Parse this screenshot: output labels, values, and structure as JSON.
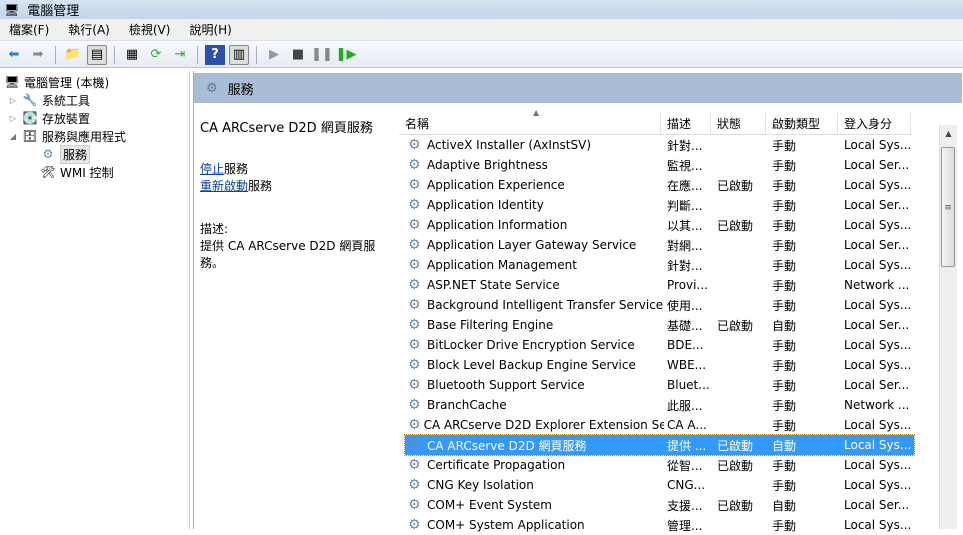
{
  "window": {
    "title": "電腦管理"
  },
  "menu": [
    "檔案(F)",
    "執行(A)",
    "檢視(V)",
    "說明(H)"
  ],
  "tree": {
    "root": "電腦管理 (本機)",
    "items": [
      {
        "label": "系統工具"
      },
      {
        "label": "存放裝置"
      },
      {
        "label": "服務與應用程式"
      },
      {
        "label": "服務"
      },
      {
        "label": "WMI 控制"
      }
    ]
  },
  "panel": {
    "header": "服務",
    "selected_title": "CA ARCserve D2D 網頁服務",
    "stop_link": "停止",
    "stop_suffix": "服務",
    "restart_link": "重新啟動",
    "restart_suffix": "服務",
    "desc_label": "描述:",
    "desc_text": "提供 CA ARCserve D2D 網頁服務。"
  },
  "columns": [
    "名稱",
    "描述",
    "狀態",
    "啟動類型",
    "登入身分"
  ],
  "services": [
    [
      "ActiveX Installer (AxInstSV)",
      "針對...",
      "",
      "手動",
      "Local Sys..."
    ],
    [
      "Adaptive Brightness",
      "監視...",
      "",
      "手動",
      "Local Ser..."
    ],
    [
      "Application Experience",
      "在應...",
      "已啟動",
      "手動",
      "Local Sys..."
    ],
    [
      "Application Identity",
      "判斷...",
      "",
      "手動",
      "Local Ser..."
    ],
    [
      "Application Information",
      "以其...",
      "已啟動",
      "手動",
      "Local Sys..."
    ],
    [
      "Application Layer Gateway Service",
      "對網...",
      "",
      "手動",
      "Local Ser..."
    ],
    [
      "Application Management",
      "針對...",
      "",
      "手動",
      "Local Sys..."
    ],
    [
      "ASP.NET State Service",
      "Provi...",
      "",
      "手動",
      "Network ..."
    ],
    [
      "Background Intelligent Transfer Service",
      "使用...",
      "",
      "手動",
      "Local Sys..."
    ],
    [
      "Base Filtering Engine",
      "基礎...",
      "已啟動",
      "自動",
      "Local Ser..."
    ],
    [
      "BitLocker Drive Encryption Service",
      "BDE...",
      "",
      "手動",
      "Local Sys..."
    ],
    [
      "Block Level Backup Engine Service",
      "WBE...",
      "",
      "手動",
      "Local Sys..."
    ],
    [
      "Bluetooth Support Service",
      "Bluet...",
      "",
      "手動",
      "Local Ser..."
    ],
    [
      "BranchCache",
      "此服...",
      "",
      "手動",
      "Network ..."
    ],
    [
      "CA ARCserve D2D Explorer Extension Se...",
      "CA A...",
      "",
      "手動",
      "Local Sys..."
    ],
    [
      "CA ARCserve D2D 網頁服務",
      "提供 ...",
      "已啟動",
      "自動",
      "Local Sys..."
    ],
    [
      "Certificate Propagation",
      "從智...",
      "已啟動",
      "手動",
      "Local Sys..."
    ],
    [
      "CNG Key Isolation",
      "CNG...",
      "",
      "手動",
      "Local Sys..."
    ],
    [
      "COM+ Event System",
      "支援...",
      "已啟動",
      "自動",
      "Local Ser..."
    ],
    [
      "COM+ System Application",
      "管理...",
      "",
      "手動",
      "Local Sys..."
    ]
  ],
  "selected_index": 15
}
